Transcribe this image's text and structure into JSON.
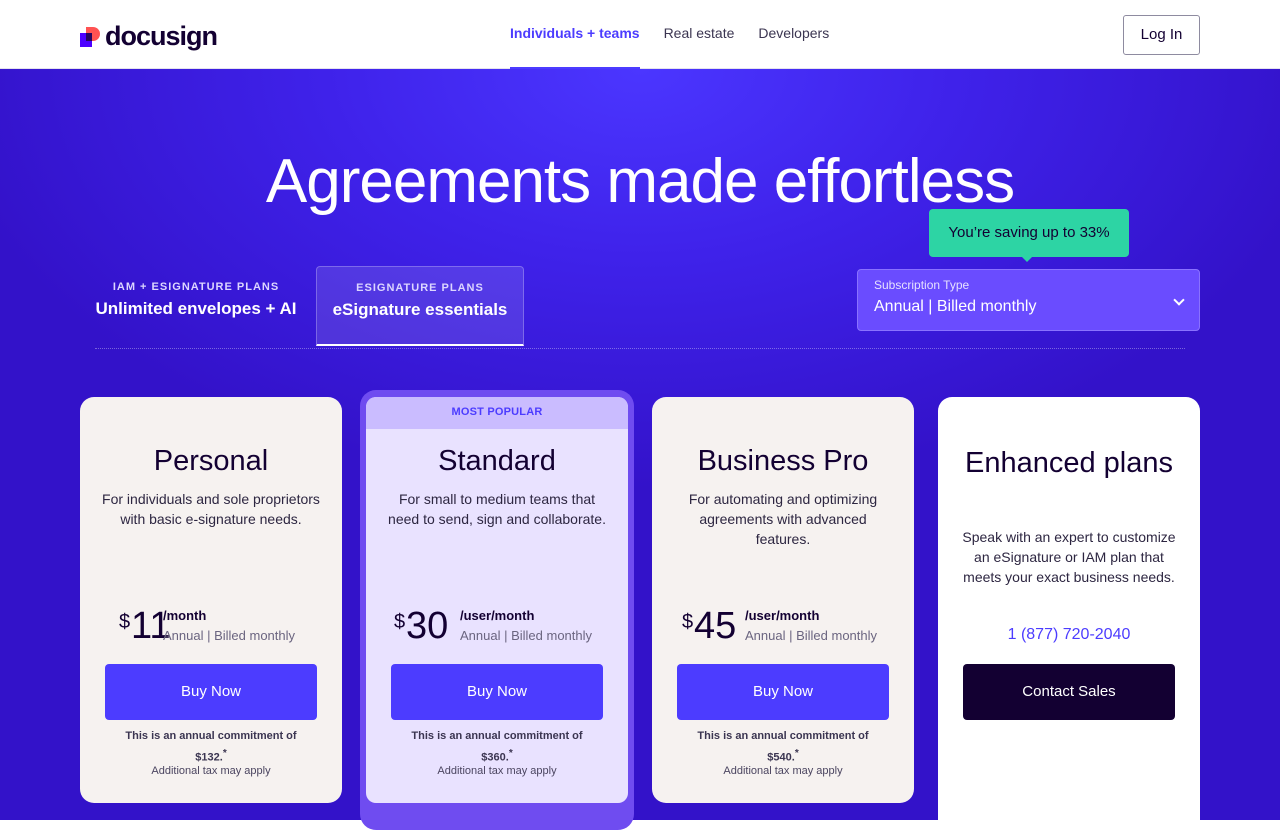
{
  "header": {
    "logo_text": "docusign",
    "nav": [
      {
        "label": "Individuals + teams",
        "active": true
      },
      {
        "label": "Real estate",
        "active": false
      },
      {
        "label": "Developers",
        "active": false
      }
    ],
    "login_label": "Log In"
  },
  "hero": {
    "title": "Agreements made effortless",
    "tabs": [
      {
        "caption": "IAM + ESIGNATURE PLANS",
        "label": "Unlimited envelopes + AI"
      },
      {
        "caption": "ESIGNATURE PLANS",
        "label": "eSignature essentials"
      }
    ],
    "saving_badge": "You’re saving up to 33%",
    "subscription": {
      "label": "Subscription Type",
      "value": "Annual | Billed monthly"
    }
  },
  "plans": [
    {
      "title": "Personal",
      "description": "For individuals and sole proprietors with basic e-signature needs.",
      "currency": "$",
      "price": "11",
      "period": "/month",
      "billing": "Annual | Billed monthly",
      "button": "Buy Now",
      "commitment": "This is an annual commitment of $132.",
      "commitment_mark": "*",
      "tax": "Additional tax may apply"
    },
    {
      "badge": "MOST POPULAR",
      "title": "Standard",
      "description": "For small to medium teams that need to send, sign and collaborate.",
      "currency": "$",
      "price": "30",
      "period": "/user/month",
      "billing": "Annual | Billed monthly",
      "button": "Buy Now",
      "commitment": "This is an annual commitment of $360.",
      "commitment_mark": "*",
      "tax": "Additional tax may apply"
    },
    {
      "title": "Business Pro",
      "description": "For automating and optimizing agreements with advanced features.",
      "currency": "$",
      "price": "45",
      "period": "/user/month",
      "billing": "Annual | Billed monthly",
      "button": "Buy Now",
      "commitment": "This is an annual commitment of $540.",
      "commitment_mark": "*",
      "tax": "Additional tax may apply"
    },
    {
      "title": "Enhanced plans",
      "description": "Speak with an expert to customize an eSignature or IAM plan that meets your exact business needs.",
      "phone": "1 (877) 720-2040",
      "button": "Contact Sales"
    }
  ],
  "colors": {
    "accent": "#4c3cff",
    "hero_bg": "#3f22ea",
    "saving_badge": "#2dd4a4",
    "dark_button": "#130032"
  }
}
